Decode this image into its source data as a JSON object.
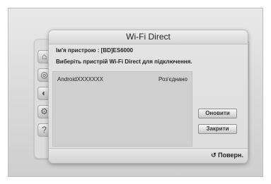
{
  "dialog": {
    "title": "Wi-Fi Direct",
    "device_name_label": "Ім'я пристрою : [BD]ES6000",
    "instruction": "Виберіть пристрій Wi-Fi Direct для підключення."
  },
  "devices": [
    {
      "name": "AndroidXXXXXXX",
      "status": "Роз'єднано"
    }
  ],
  "buttons": {
    "refresh": "Оновити",
    "close": "Закрити"
  },
  "footer": {
    "back_icon": "↺",
    "back_label": "Поверн."
  },
  "background_icons": [
    "home-icon",
    "settings-icon",
    "globe-icon",
    "gear-icon",
    "help-icon"
  ]
}
